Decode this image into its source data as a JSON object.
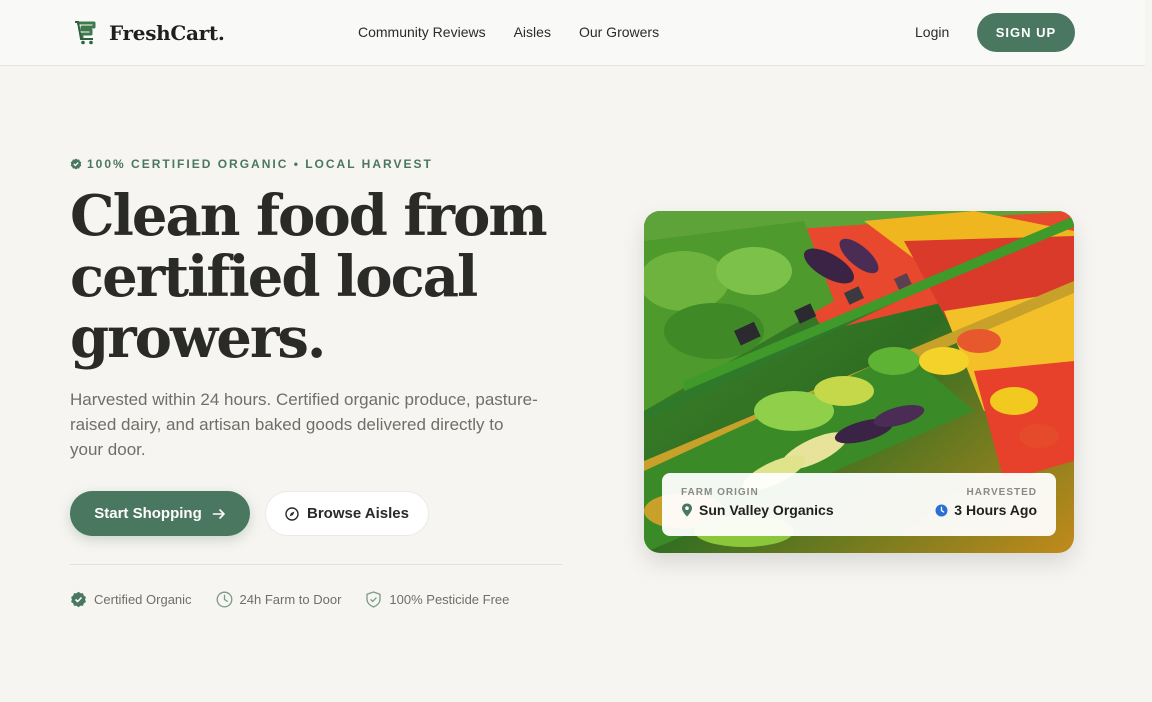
{
  "brand": {
    "name": "FreshCart.",
    "icon": "logo-f-cart-icon",
    "accent": "#4a7760"
  },
  "nav": {
    "items": [
      "Community Reviews",
      "Aisles",
      "Our Growers"
    ]
  },
  "auth": {
    "login": "Login",
    "signup": "SIGN UP"
  },
  "hero": {
    "eyebrow": "100% CERTIFIED ORGANIC • LOCAL HARVEST",
    "title_lines": [
      "Clean food from",
      "certified local",
      "growers."
    ],
    "subtitle": "Harvested within 24 hours. Certified organic produce, pasture-raised dairy, and artisan baked goods delivered directly to your door.",
    "primary_cta": "Start Shopping",
    "secondary_cta": "Browse Aisles"
  },
  "badges": [
    {
      "label": "Certified Organic",
      "icon": "check-badge-icon"
    },
    {
      "label": "24h Farm to Door",
      "icon": "clock-icon"
    },
    {
      "label": "100% Pesticide Free",
      "icon": "shield-check-icon"
    }
  ],
  "card": {
    "farm_label": "FARM ORIGIN",
    "farm_value": "Sun Valley Organics",
    "harvest_label": "HARVESTED",
    "harvest_value": "3 Hours Ago"
  }
}
